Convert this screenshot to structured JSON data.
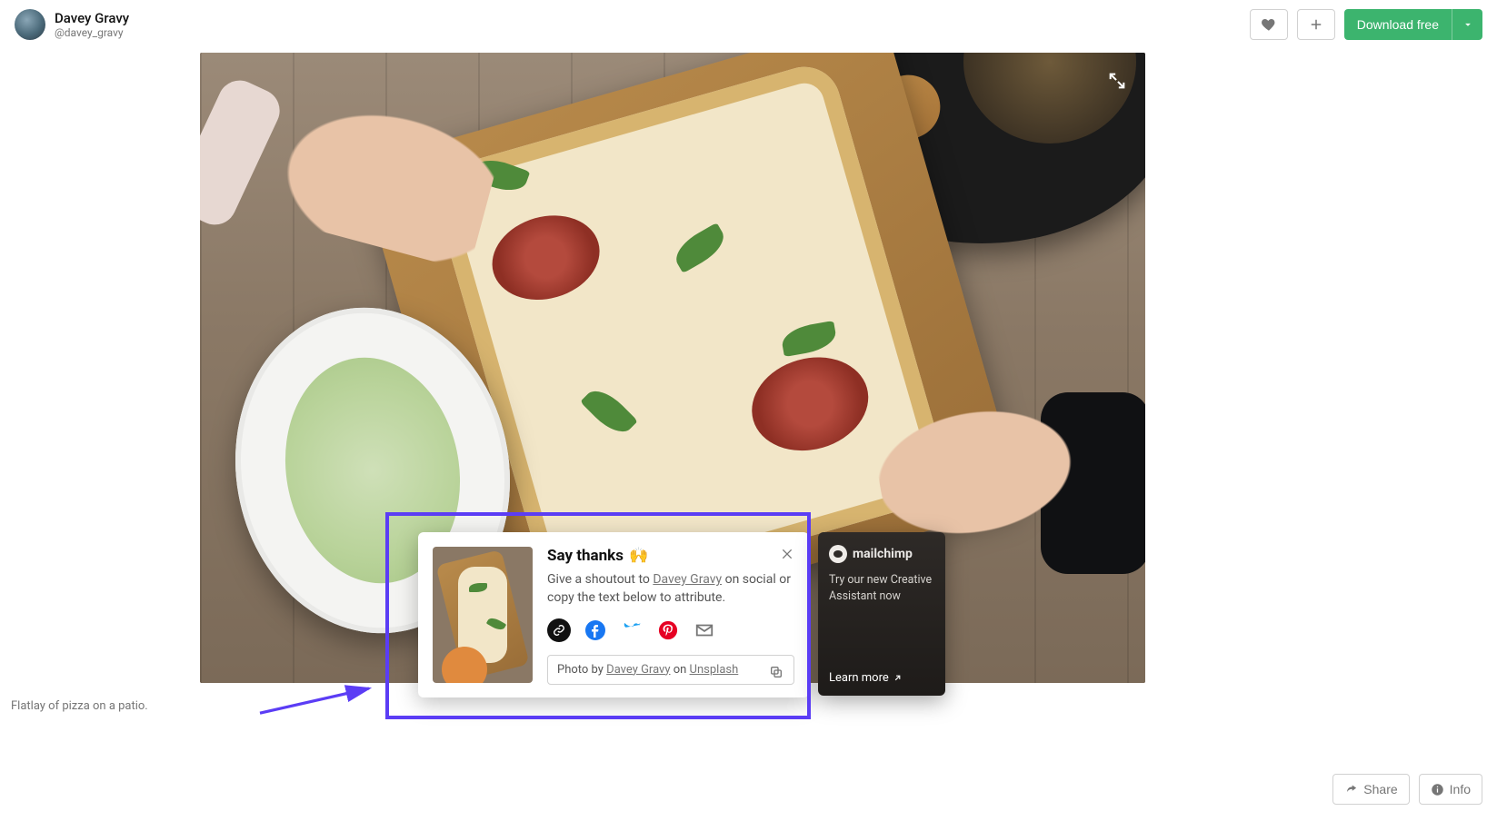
{
  "header": {
    "author_name": "Davey Gravy",
    "author_handle": "@davey_gravy",
    "download_label": "Download free"
  },
  "caption": "Flatlay of pizza on a patio.",
  "footer": {
    "share_label": "Share",
    "info_label": "Info"
  },
  "thanks": {
    "title": "Say thanks",
    "emoji": "🙌",
    "desc_prefix": "Give a shoutout to ",
    "desc_link": "Davey Gravy",
    "desc_suffix": " on social or copy the text below to attribute.",
    "attrib_prefix": "Photo by ",
    "attrib_author": "Davey Gravy",
    "attrib_middle": " on ",
    "attrib_site": "Unsplash"
  },
  "promo": {
    "brand": "mailchimp",
    "text": "Try our new Creative Assistant now",
    "cta": "Learn more"
  }
}
